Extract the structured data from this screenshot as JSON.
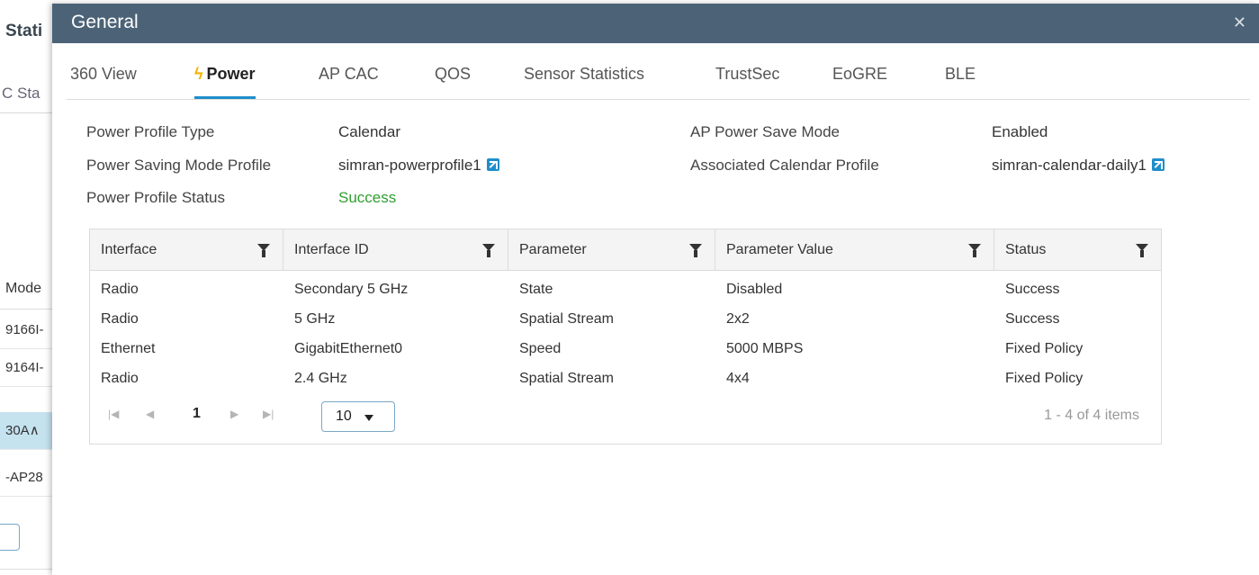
{
  "background": {
    "title": "Stati",
    "subtitle": "C Sta",
    "column": "Mode",
    "rows": [
      "9166I-",
      "9164I-",
      "30A∧",
      "-AP28"
    ]
  },
  "modal": {
    "title": "General",
    "close_icon": "close-icon"
  },
  "tabs": [
    {
      "label": "360 View",
      "active": false
    },
    {
      "label": "Power",
      "active": true,
      "icon": "lightning-icon"
    },
    {
      "label": "AP CAC",
      "active": false
    },
    {
      "label": "QOS",
      "active": false
    },
    {
      "label": "Sensor Statistics",
      "active": false
    },
    {
      "label": "TrustSec",
      "active": false
    },
    {
      "label": "EoGRE",
      "active": false
    },
    {
      "label": "BLE",
      "active": false
    }
  ],
  "power_info": {
    "left": [
      {
        "label": "Power Profile Type",
        "value": "Calendar"
      },
      {
        "label": "Power Saving Mode Profile",
        "value": "simran-powerprofile1",
        "link_icon": "external-link-icon"
      },
      {
        "label": "Power Profile Status",
        "value": "Success",
        "status_color": "#2f9e2f"
      }
    ],
    "right": [
      {
        "label": "AP Power Save Mode",
        "value": "Enabled"
      },
      {
        "label": "Associated Calendar Profile",
        "value": "simran-calendar-daily1",
        "link_icon": "external-link-icon"
      }
    ]
  },
  "grid": {
    "columns": [
      "Interface",
      "Interface ID",
      "Parameter",
      "Parameter Value",
      "Status"
    ],
    "rows": [
      [
        "Radio",
        "Secondary 5 GHz",
        "State",
        "Disabled",
        "Success"
      ],
      [
        "Radio",
        "5 GHz",
        "Spatial Stream",
        "2x2",
        "Success"
      ],
      [
        "Ethernet",
        "GigabitEthernet0",
        "Speed",
        "5000 MBPS",
        "Fixed Policy"
      ],
      [
        "Radio",
        "2.4 GHz",
        "Spatial Stream",
        "4x4",
        "Fixed Policy"
      ]
    ],
    "pager": {
      "current_page": "1",
      "page_size": "10",
      "items_info": "1 - 4 of 4 items"
    }
  },
  "colors": {
    "header_bg": "#4c6377",
    "accent": "#1f8ecb",
    "success": "#2f9e2f",
    "bolt": "#f4b400"
  }
}
